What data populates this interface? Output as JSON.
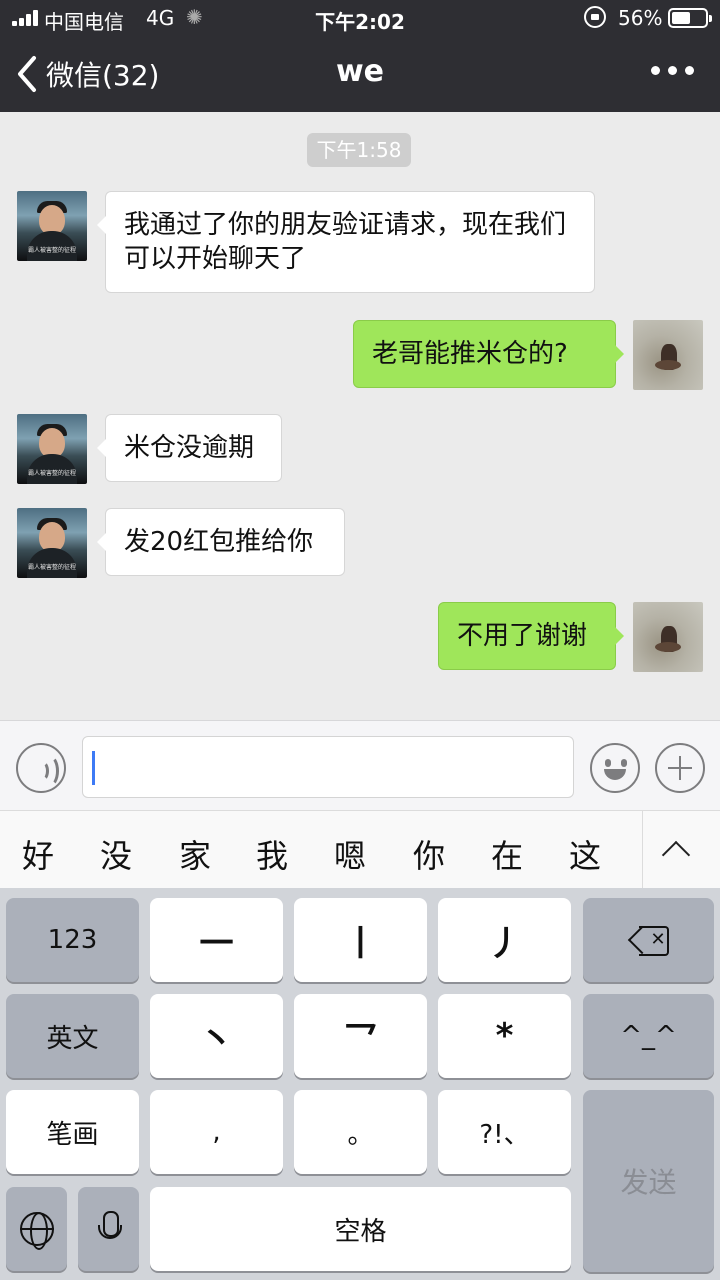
{
  "status_bar": {
    "carrier": "中国电信",
    "network": "4G",
    "time": "下午2:02",
    "battery_percent": "56%",
    "battery_level": 0.56
  },
  "nav": {
    "back_label": "微信(32)",
    "title": "we"
  },
  "chat": {
    "timestamp": "下午1:58",
    "avatar_caption": "霸人被害整的征程",
    "messages": [
      {
        "side": "in",
        "text": "我通过了你的朋友验证请求，现在我们可以开始聊天了"
      },
      {
        "side": "out",
        "text": "老哥能推米仓的?"
      },
      {
        "side": "in",
        "text": "米仓没逾期"
      },
      {
        "side": "in",
        "text": "发20红包推给你"
      },
      {
        "side": "out",
        "text": "不用了谢谢"
      }
    ]
  },
  "input": {
    "value": "",
    "placeholder": ""
  },
  "candidates": [
    "好",
    "没",
    "家",
    "我",
    "嗯",
    "你",
    "在",
    "这"
  ],
  "keyboard": {
    "row1": {
      "left": "123",
      "keys": [
        "一",
        "丨",
        "丿"
      ]
    },
    "row2": {
      "left": "英文",
      "keys": [
        "丶",
        "乛",
        "*"
      ],
      "right": "^_^"
    },
    "row3": {
      "left": "笔画",
      "keys": [
        ",",
        "。",
        "?!、"
      ]
    },
    "space": "空格",
    "send": "发送"
  },
  "colors": {
    "nav_bg": "#2e2e33",
    "chat_bg": "#ebebeb",
    "bubble_out": "#9fe65a",
    "bubble_in": "#ffffff",
    "keyboard_bg": "#d1d4d9"
  }
}
